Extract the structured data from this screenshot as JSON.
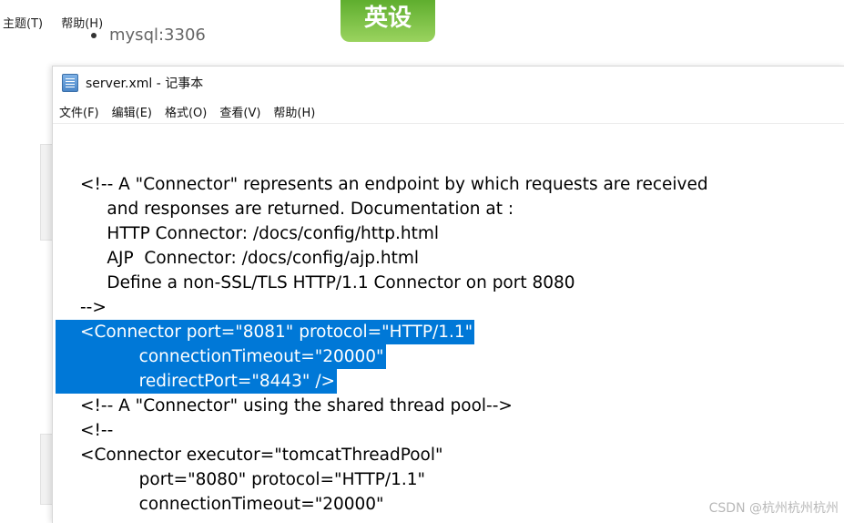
{
  "background_app": {
    "menu": [
      "主题(T)",
      "帮助(H)"
    ],
    "bullet_text": "mysql:3306",
    "logo_text": "英设"
  },
  "notepad": {
    "title": "server.xml - 记事本",
    "menu": [
      "文件(F)",
      "编辑(E)",
      "格式(O)",
      "查看(V)",
      "帮助(H)"
    ],
    "lines": [
      "<!-- A \"Connector\" represents an endpoint by which requests are received",
      "     and responses are returned. Documentation at :",
      "     HTTP Connector: /docs/config/http.html",
      "     AJP  Connector: /docs/config/ajp.html",
      "     Define a non-SSL/TLS HTTP/1.1 Connector on port 8080",
      "-->",
      "<Connector port=\"8081\" protocol=\"HTTP/1.1\"",
      "           connectionTimeout=\"20000\"",
      "           redirectPort=\"8443\" />",
      "<!-- A \"Connector\" using the shared thread pool-->",
      "<!--",
      "<Connector executor=\"tomcatThreadPool\"",
      "           port=\"8080\" protocol=\"HTTP/1.1\"",
      "           connectionTimeout=\"20000\""
    ]
  },
  "watermark": "CSDN @杭州杭州杭州"
}
